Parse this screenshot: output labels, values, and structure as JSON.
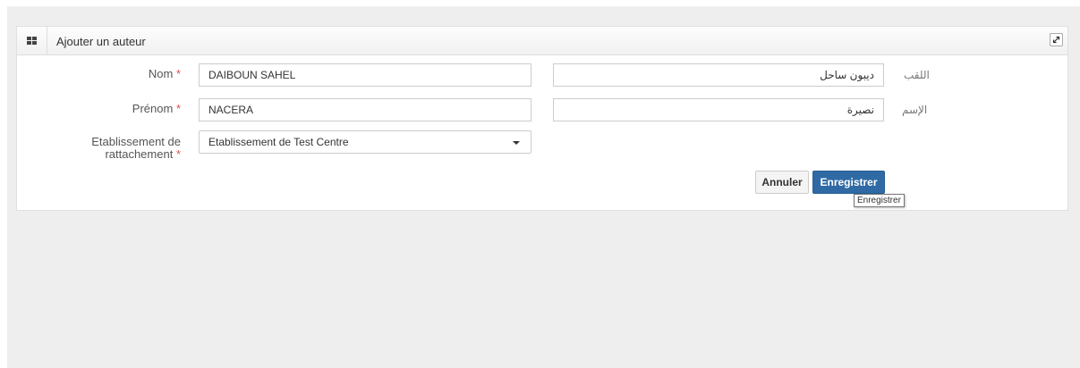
{
  "widget": {
    "title": "Ajouter un auteur",
    "icons": {
      "header": "grid-icon",
      "expand": "expand-icon"
    }
  },
  "form": {
    "nom": {
      "label": "Nom",
      "required_mark": "*",
      "value": "DAIBOUN SAHEL",
      "ar_value": "ديبون ساحل",
      "ar_label": "اللقب"
    },
    "prenom": {
      "label": "Prénom",
      "required_mark": "*",
      "value": "NACERA",
      "ar_value": "نصيرة",
      "ar_label": "الإسم"
    },
    "etablissement": {
      "label_line1": "Etablissement de",
      "label_line2": "rattachement",
      "required_mark": "*",
      "selected": "Etablissement de Test Centre"
    }
  },
  "actions": {
    "cancel_label": "Annuler",
    "save_label": "Enregistrer",
    "save_tooltip": "Enregistrer"
  },
  "colors": {
    "primary": "#2f6aa5",
    "required": "#d9534f",
    "page_background": "#eeeeee"
  }
}
